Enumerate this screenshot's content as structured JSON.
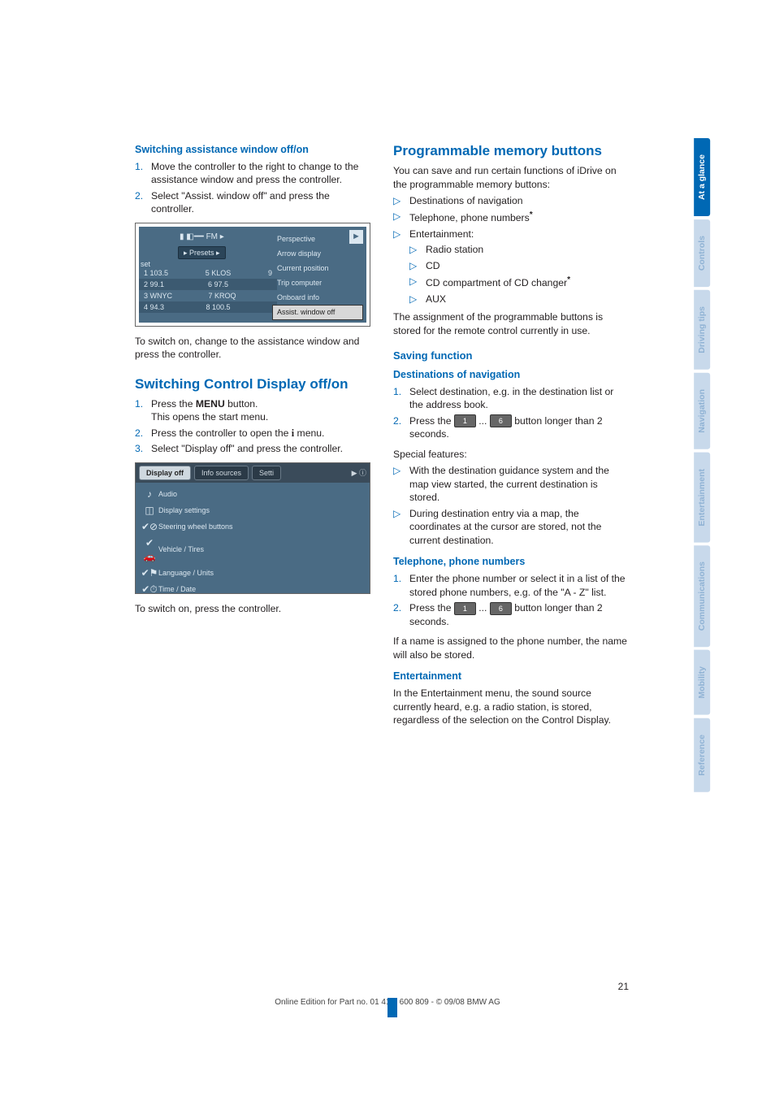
{
  "side_tabs": [
    {
      "label": "At a glance",
      "active": true
    },
    {
      "label": "Controls",
      "active": false
    },
    {
      "label": "Driving tips",
      "active": false
    },
    {
      "label": "Navigation",
      "active": false
    },
    {
      "label": "Entertainment",
      "active": false
    },
    {
      "label": "Communications",
      "active": false
    },
    {
      "label": "Mobility",
      "active": false
    },
    {
      "label": "Reference",
      "active": false
    }
  ],
  "left": {
    "sect1": {
      "title": "Switching assistance window off/on",
      "steps": [
        "Move the controller to the right to change to the assistance window and press the controller.",
        "Select \"Assist. window off\" and press the controller."
      ],
      "caption": "To switch on, change to the assistance window and press the controller."
    },
    "fig1": {
      "topband": "FM",
      "presets": "▸ Presets ▸",
      "set": "set",
      "rows": [
        {
          "a": "1 103.5",
          "b": "5 KLOS",
          "c": "9"
        },
        {
          "a": "2 99.1",
          "b": "6 97.5",
          "c": ""
        },
        {
          "a": "3 WNYC",
          "b": "7 KROQ",
          "c": ""
        },
        {
          "a": "4 94.3",
          "b": "8 100.5",
          "c": ""
        }
      ],
      "right": [
        "Perspective",
        "Arrow display",
        "Current position",
        "Trip computer",
        "Onboard info",
        "Assist. window off"
      ],
      "selected": "Assist. window off",
      "arrow": "►"
    },
    "sect2": {
      "title": "Switching Control Display off/on",
      "steps": [
        {
          "pre": "Press the ",
          "btn": "MENU",
          "post": " button.",
          "extra": "This opens the start menu."
        },
        {
          "pre": "Press the controller to open the ",
          "btn_i": true,
          "post": " menu."
        },
        {
          "pre": "Select \"Display off\" and press the controller."
        }
      ],
      "caption": "To switch on, press the controller."
    },
    "fig2": {
      "tabs": [
        "Display off",
        "Info sources",
        "Setti"
      ],
      "chev": "▶  ⓘ",
      "menu": [
        {
          "icon": "♪",
          "label": "Audio"
        },
        {
          "icon": "◫",
          "label": "Display settings"
        },
        {
          "icon": "✔⊘",
          "label": "Steering wheel buttons"
        },
        {
          "icon": "✔🚗",
          "label": "Vehicle / Tires"
        },
        {
          "icon": "✔⚑",
          "label": "Language / Units"
        },
        {
          "icon": "✔⏱",
          "label": "Time / Date"
        }
      ]
    }
  },
  "right": {
    "title": "Programmable memory buttons",
    "intro": "You can save and run certain functions of iDrive on the programmable memory buttons:",
    "bul": [
      {
        "text": "Destinations of navigation"
      },
      {
        "text": "Telephone, phone numbers",
        "ast": true
      },
      {
        "text": "Entertainment:",
        "sub": [
          {
            "text": "Radio station"
          },
          {
            "text": "CD"
          },
          {
            "text": "CD compartment of CD changer",
            "ast": true
          },
          {
            "text": "AUX"
          }
        ]
      }
    ],
    "assign": "The assignment of the programmable buttons is stored for the remote control currently in use.",
    "saving": "Saving function",
    "dest": {
      "title": "Destinations of navigation",
      "steps": [
        "Select destination, e.g. in the destination list or the address book.",
        {
          "pre": "Press the ",
          "k1": "1",
          "mid": " ... ",
          "k2": "6",
          "post": " button longer than 2 seconds."
        }
      ],
      "special_hdr": "Special features:",
      "special": [
        "With the destination guidance system and the map view started, the current destination is stored.",
        "During destination entry via a map, the coordinates at the cursor are stored, not the current destination."
      ]
    },
    "tel": {
      "title": "Telephone, phone numbers",
      "steps": [
        "Enter the phone number or select it in a list of the stored phone numbers, e.g. of the \"A - Z\" list.",
        {
          "pre": "Press the ",
          "k1": "1",
          "mid": " ... ",
          "k2": "6",
          "post": " button longer than 2 seconds."
        }
      ],
      "note": "If a name is assigned to the phone number, the name will also be stored."
    },
    "ent": {
      "title": "Entertainment",
      "body": "In the Entertainment menu, the sound source currently heard, e.g. a radio station, is stored, regardless of the selection on the Control Display."
    }
  },
  "footer": {
    "page": "21",
    "line": "Online Edition for Part no. 01 41 2 600 809 - © 09/08 BMW AG"
  }
}
